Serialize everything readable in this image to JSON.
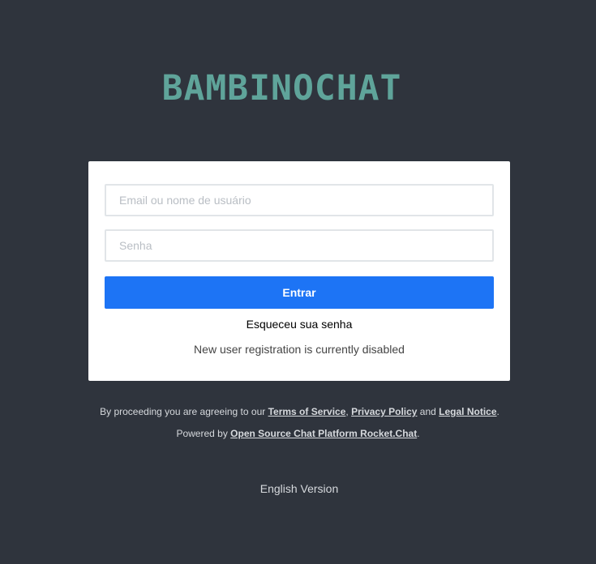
{
  "brand": {
    "logo_text": "BAMBINOCHAT",
    "logo_color": "#5fa49a"
  },
  "login": {
    "email_placeholder": "Email ou nome de usuário",
    "email_value": "",
    "password_placeholder": "Senha",
    "password_value": "",
    "submit_label": "Entrar",
    "forgot_label": "Esqueceu sua senha",
    "registration_notice": "New user registration is currently disabled"
  },
  "footer": {
    "terms_prefix": "By proceeding you are agreeing to our ",
    "terms_link": "Terms of Service",
    "sep_comma": ", ",
    "privacy_link": "Privacy Policy",
    "sep_and": " and ",
    "legal_link": "Legal Notice",
    "terms_suffix": ".",
    "powered_prefix": "Powered by ",
    "powered_link": "Open Source Chat Platform Rocket.Chat",
    "powered_suffix": ".",
    "language_link": "English Version"
  },
  "colors": {
    "background": "#2f343d",
    "card": "#ffffff",
    "primary": "#1d74f5",
    "footer_text": "#d6d9dd"
  }
}
